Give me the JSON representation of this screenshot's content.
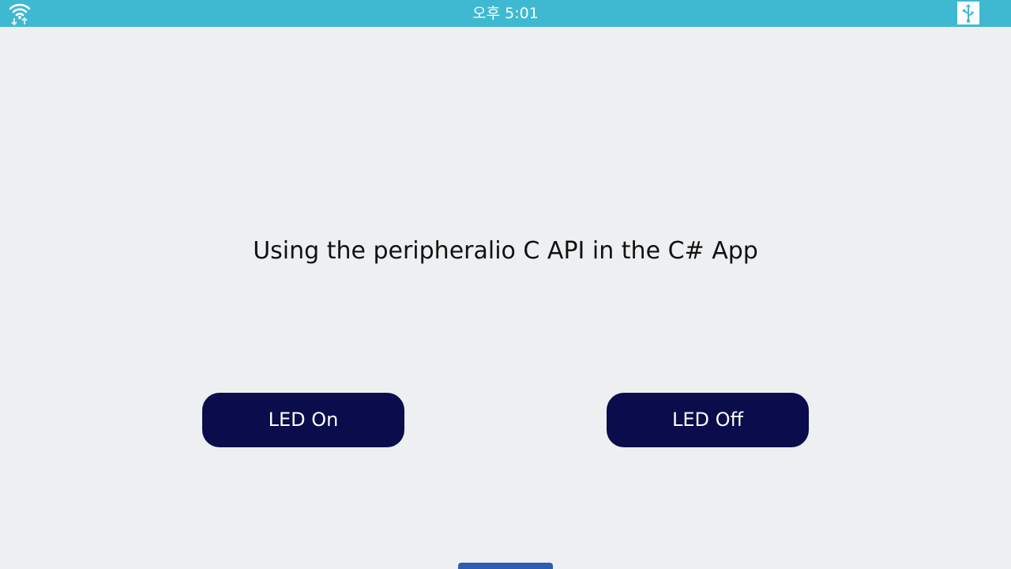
{
  "status_bar": {
    "time": "오후 5:01",
    "wifi_icon": "wifi-icon",
    "usb_icon": "usb-icon",
    "background_color": "#3eb9d1"
  },
  "main": {
    "title": "Using the peripheralio C API in the C# App"
  },
  "buttons": {
    "led_on": "LED On",
    "led_off": "LED Off",
    "background_color": "#0b0c4b"
  },
  "navigation": {
    "home_handle_color": "#2b5eb0"
  }
}
